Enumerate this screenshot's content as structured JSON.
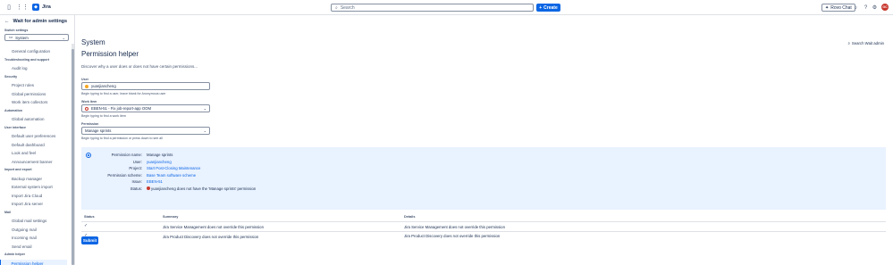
{
  "topbar": {
    "app_name": "Jira",
    "search_placeholder": "Search",
    "create_label": "Create",
    "rovo_label": "Rovo Chat",
    "avatar_initials": "GC"
  },
  "sidebar": {
    "back_label": "Wait for admin settings",
    "switch_label": "Switch settings",
    "switch_value": "System",
    "groups": [
      {
        "title": "",
        "items": [
          "General configuration"
        ]
      },
      {
        "title": "Troubleshooting and support",
        "items": [
          "Audit log"
        ]
      },
      {
        "title": "Security",
        "items": [
          "Project roles",
          "Global permissions",
          "Work item collectors"
        ]
      },
      {
        "title": "Automation",
        "items": [
          "Global automation"
        ]
      },
      {
        "title": "User interface",
        "items": [
          "Default user preferences",
          "Default dashboard",
          "Look and feel",
          "Announcement banner"
        ]
      },
      {
        "title": "Import and export",
        "items": [
          "Backup manager",
          "External system import",
          "Import Jira Cloud",
          "Import Jira server"
        ]
      },
      {
        "title": "Mail",
        "items": [
          "Global mail settings",
          "Outgoing mail",
          "Incoming mail",
          "Send email"
        ]
      },
      {
        "title": "Admin helper",
        "items": [
          "Permission helper"
        ]
      }
    ],
    "active_item": "Permission helper"
  },
  "main": {
    "breadcrumb": "System",
    "title": "Permission helper",
    "search_wait_admin": "Search Wait admin",
    "description": "Discover why a user does or does not have certain permissions...",
    "user_label": "User",
    "user_value": "yuanjiancheng",
    "user_help": "Begin typing to find a user, leave blank for Anonymous user",
    "workitem_label": "Work item",
    "workitem_value": "EBEN-51 - Fix job-report-app OOM",
    "workitem_help": "Begin typing to find a work item",
    "permission_label": "Permission",
    "permission_value": "Manage sprints",
    "permission_help": "Begin typing to find a permission or press down to see all",
    "result": {
      "permission_name_label": "Permission name:",
      "permission_name": "Manage sprints",
      "user_label": "User:",
      "user": "yuanjiancheng",
      "project_label": "Project:",
      "project": "Start Post-Closing Maintenance",
      "scheme_label": "Permission scheme:",
      "scheme": "Base Team software scheme",
      "issue_label": "Issue:",
      "issue": "EBEN-51",
      "status_label": "Status:",
      "status": "yuanjiancheng does not have the 'Manage sprints' permission"
    },
    "table": {
      "headers": [
        "Status",
        "Summary",
        "Details"
      ],
      "rows": [
        {
          "summary": "Jira Service Management does not override this permission",
          "details": "Jira Service Management does not override this permission"
        },
        {
          "summary": "Jira Product Discovery does not override this permission",
          "details": "Jira Product Discovery does not override this permission"
        }
      ]
    },
    "submit_label": "Submit"
  },
  "colors": {
    "accent": "#0c66e4",
    "error": "#c9372c",
    "panel_bg": "#e9f2ff"
  }
}
